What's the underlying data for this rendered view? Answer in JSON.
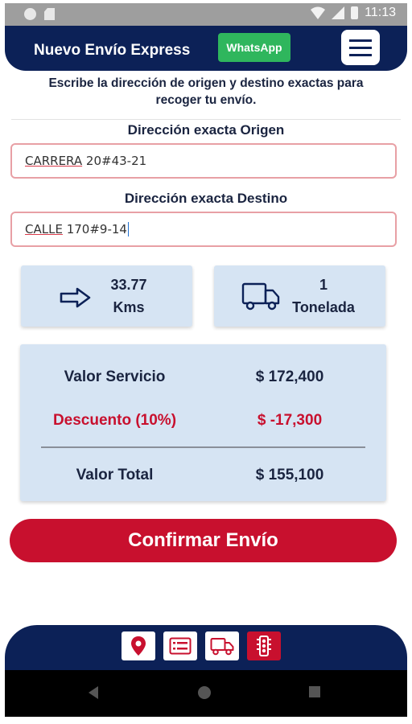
{
  "status_bar": {
    "time": "11:13",
    "left_icons": [
      "circle-icon",
      "sd-card-icon"
    ],
    "right_icons": [
      "wifi-icon",
      "signal-icon",
      "battery-icon"
    ]
  },
  "header": {
    "title": "Nuevo Envío Express",
    "whatsapp_label": "WhatsApp",
    "menu_icon": "hamburger-icon"
  },
  "instructions": {
    "line1": "Escribe la dirección de origen y destino exactas para",
    "line2": "recoger tu envío."
  },
  "origin": {
    "label": "Dirección exacta Origen",
    "value_underlined": "CARRERA",
    "value_rest": " 20#43-21"
  },
  "destination": {
    "label": "Dirección exacta Destino",
    "value_underlined": "CALLE",
    "value_rest": " 170#9-14"
  },
  "distance_card": {
    "icon": "arrow-right-icon",
    "line1": "33.77",
    "line2": "Kms"
  },
  "weight_card": {
    "icon": "truck-icon",
    "line1": "1",
    "line2": "Tonelada"
  },
  "summary": {
    "service_label": "Valor Servicio",
    "service_value": "$ 172,400",
    "discount_label": "Descuento (10%)",
    "discount_value": "$ -17,300",
    "total_label": "Valor Total",
    "total_value": "$ 155,100"
  },
  "confirm_button": "Confirmar Envío",
  "bottom_nav": [
    {
      "icon": "location-pin-icon",
      "active": false
    },
    {
      "icon": "id-card-icon",
      "active": false
    },
    {
      "icon": "truck-icon",
      "active": false
    },
    {
      "icon": "traffic-light-icon",
      "active": true
    }
  ],
  "colors": {
    "navy": "#0c2157",
    "red": "#c8102e",
    "whatsapp_green": "#2fb65d",
    "card_blue": "#d6e4f3"
  }
}
